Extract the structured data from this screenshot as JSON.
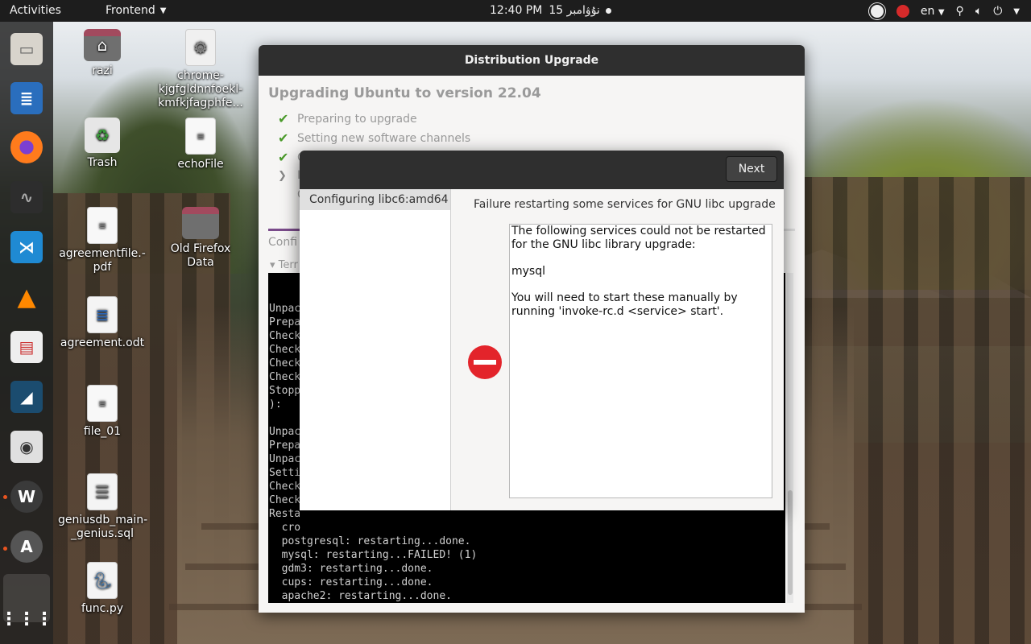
{
  "topbar": {
    "activities": "Activities",
    "app_name": "Frontend",
    "clock_time": "12:40 PM",
    "clock_date": "15 نۇۋامبر",
    "language": "en"
  },
  "dock": {
    "items": [
      "files",
      "writer",
      "firefox",
      "system-monitor",
      "vscode",
      "vlc",
      "evince",
      "mysql-workbench",
      "screenshot",
      "wps",
      "update-manager",
      "app-grid"
    ]
  },
  "desktop": {
    "icons": [
      {
        "label": "razi"
      },
      {
        "label": "chrome-kjgfgldnnfoekl-kmfkjfagphfe..."
      },
      {
        "label": "Trash"
      },
      {
        "label": "echoFile"
      },
      {
        "label": "agreementfile.-pdf"
      },
      {
        "label": "Old Firefox Data"
      },
      {
        "label": "agreement.odt"
      },
      {
        "label": "file_01"
      },
      {
        "label": "geniusdb_main-_genius.sql"
      },
      {
        "label": "func.py"
      }
    ]
  },
  "upgrade_window": {
    "title": "Distribution Upgrade",
    "heading": "Upgrading Ubuntu to version 22.04",
    "steps": [
      {
        "label": "Preparing to upgrade",
        "state": "done"
      },
      {
        "label": "Setting new software channels",
        "state": "done"
      },
      {
        "label": "C",
        "state": "done"
      },
      {
        "label": "I",
        "state": "current"
      },
      {
        "label": "C",
        "state": "pending"
      }
    ],
    "config_label": "Confi",
    "terminal_label": "Terr",
    "terminal_lines": [
      "Unpac",
      "Prepa",
      "Check",
      "Check",
      "Check",
      "Check",
      "Stopp",
      "):",
      "",
      "Unpac",
      "Prepa",
      "Unpac",
      "Setti",
      "Check",
      "Check",
      "Resta",
      "  cro",
      "  postgresql: restarting...done.",
      "  mysql: restarting...FAILED! (1)",
      "  gdm3: restarting...done.",
      "  cups: restarting...done.",
      "  apache2: restarting...done.",
      ""
    ]
  },
  "dialog": {
    "next_label": "Next",
    "sidebar_item": "Configuring libc6:amd64",
    "question": "Failure restarting some services for GNU libc upgrade",
    "message": {
      "p1": "The following services could not be restarted for the GNU libc library upgrade:",
      "p2": "mysql",
      "p3": "You will need to start these manually by running 'invoke-rc.d <service> start'."
    }
  }
}
